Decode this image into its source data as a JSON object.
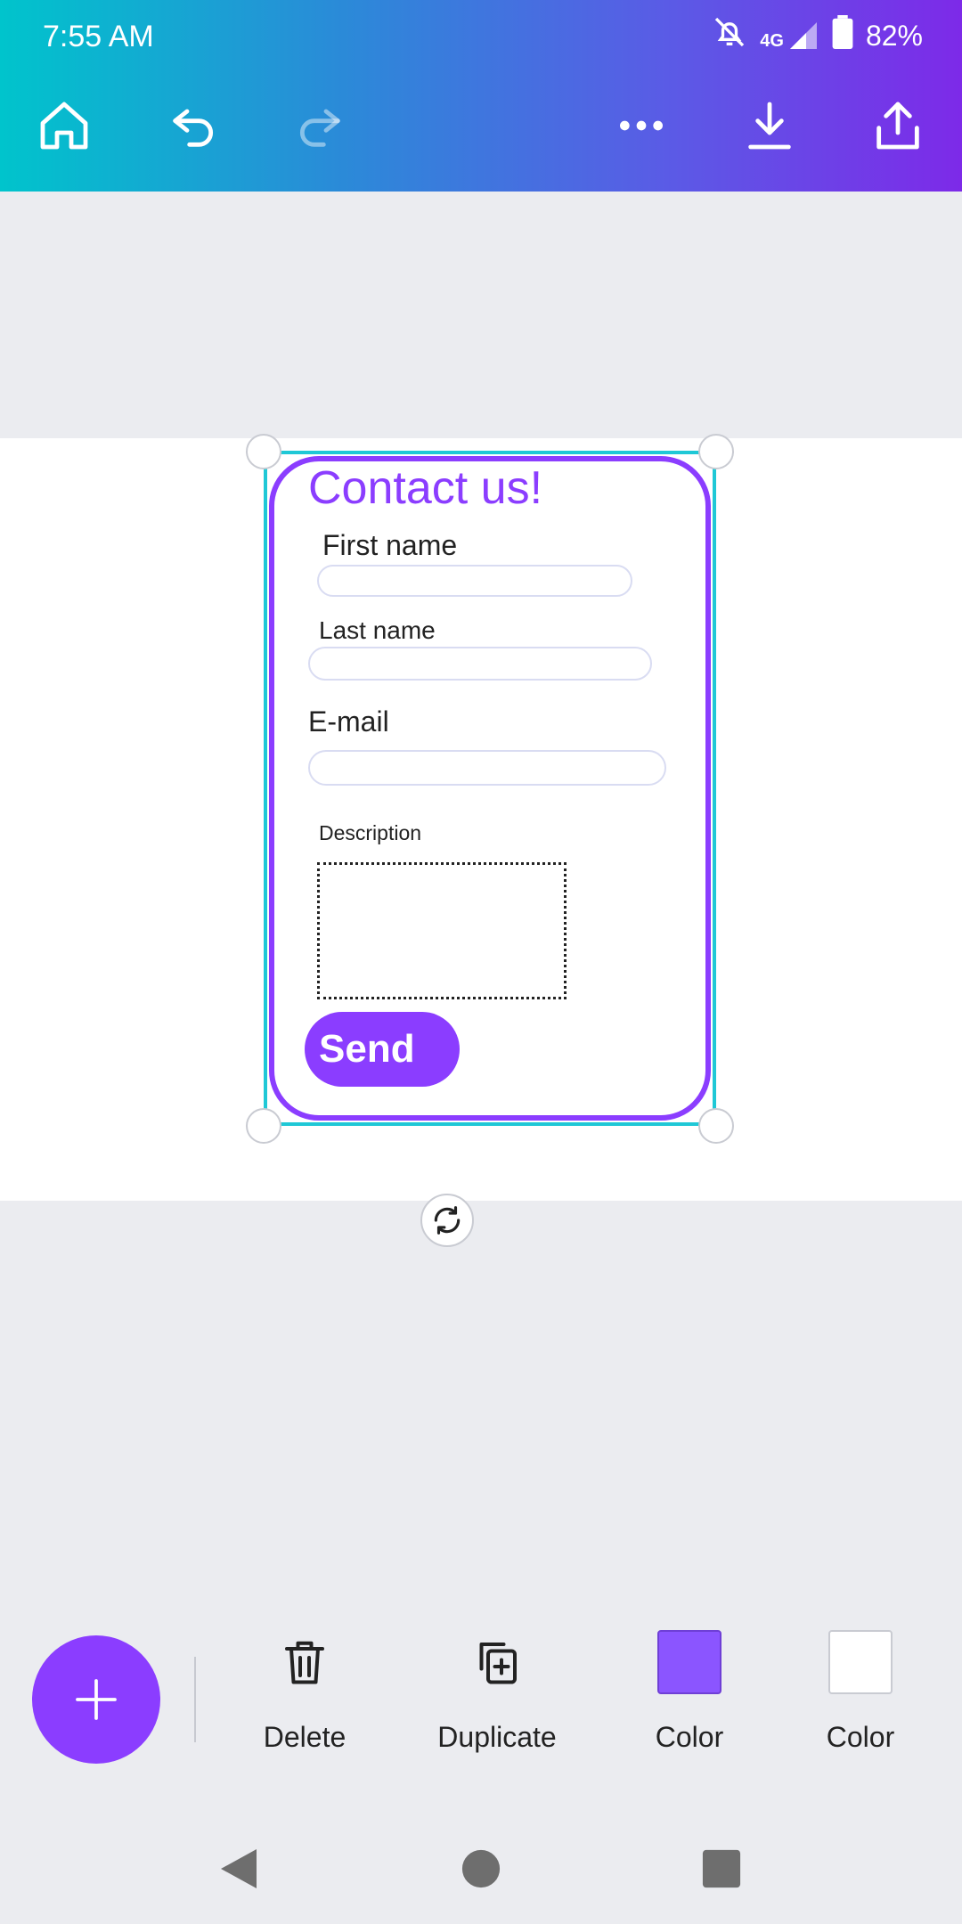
{
  "status": {
    "time": "7:55 AM",
    "network": "4G",
    "battery": "82%"
  },
  "toolbar": {
    "home": "home-icon",
    "undo": "undo-icon",
    "redo": "redo-icon",
    "more": "more-icon",
    "download": "download-icon",
    "share": "share-icon"
  },
  "form": {
    "title": "Contact us!",
    "first_name": "First name",
    "last_name": "Last name",
    "email": "E-mail",
    "description": "Description",
    "send": "Send"
  },
  "actions": {
    "delete": "Delete",
    "duplicate": "Duplicate",
    "color1": "Color",
    "color2": "Color"
  },
  "colors": {
    "accent": "#8b3dff",
    "swatch1": "#8b55ff",
    "swatch2": "#ffffff",
    "selection": "#1fc8d6"
  }
}
